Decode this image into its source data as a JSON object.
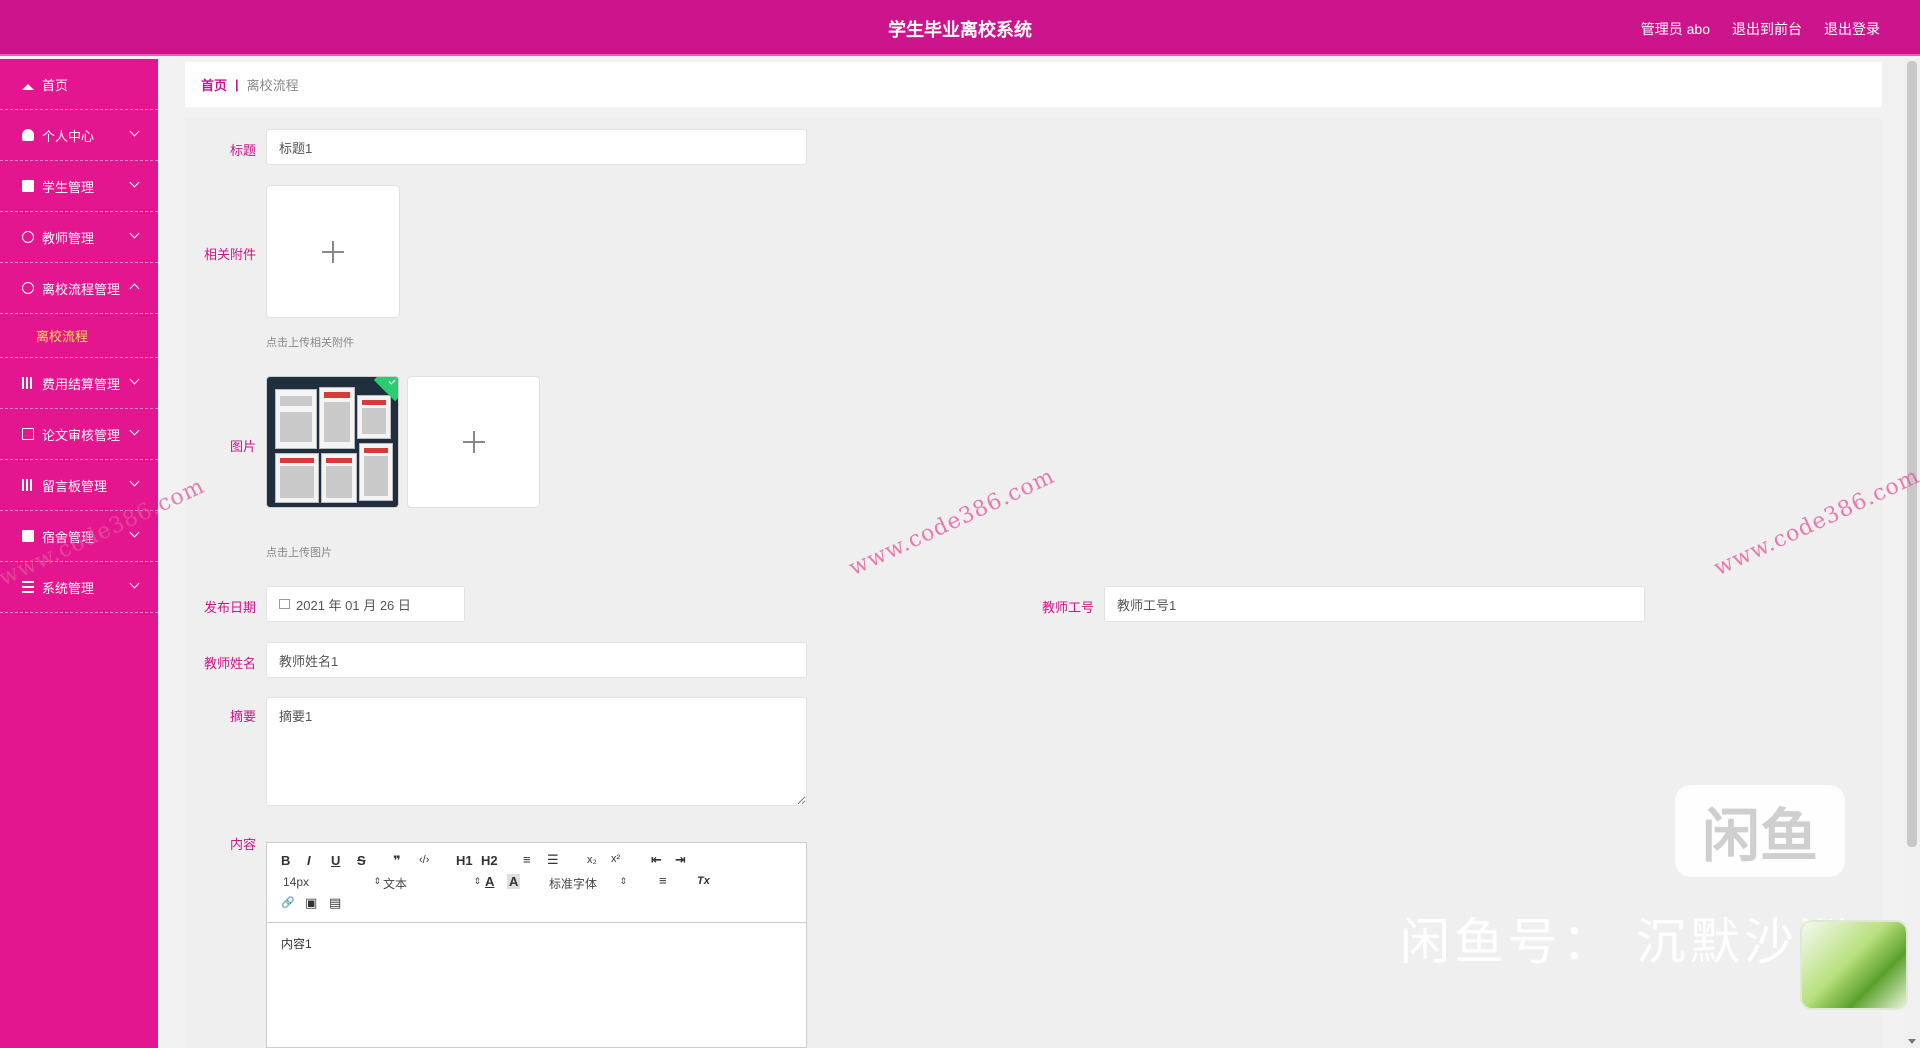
{
  "app": {
    "title": "学生毕业离校系统",
    "admin_label": "管理员 abo",
    "back_to_frontend": "退出到前台",
    "logout": "退出登录"
  },
  "sidebar": {
    "items": [
      {
        "label": "首页",
        "icon": "home-icon"
      },
      {
        "label": "个人中心",
        "icon": "user-icon"
      },
      {
        "label": "学生管理",
        "icon": "student-icon"
      },
      {
        "label": "教师管理",
        "icon": "teacher-icon"
      },
      {
        "label": "离校流程管理",
        "icon": "process-icon"
      },
      {
        "label": "离校流程",
        "icon": ""
      },
      {
        "label": "费用结算管理",
        "icon": "fee-icon"
      },
      {
        "label": "论文审核管理",
        "icon": "paper-icon"
      },
      {
        "label": "留言板管理",
        "icon": "message-icon"
      },
      {
        "label": "宿舍管理",
        "icon": "dorm-icon"
      },
      {
        "label": "系统管理",
        "icon": "settings-icon"
      }
    ]
  },
  "breadcrumb": {
    "home": "首页",
    "separator": "|",
    "current": "离校流程"
  },
  "form": {
    "title_label": "标题",
    "title_value": "标题1",
    "attachment_label": "相关附件",
    "attachment_hint": "点击上传相关附件",
    "image_label": "图片",
    "image_hint": "点击上传图片",
    "date_label": "发布日期",
    "date_value": "2021 年 01 月 26 日",
    "teacher_id_label": "教师工号",
    "teacher_id_value": "教师工号1",
    "teacher_name_label": "教师姓名",
    "teacher_name_value": "教师姓名1",
    "summary_label": "摘要",
    "summary_value": "摘要1",
    "content_label": "内容",
    "content_value": "内容1"
  },
  "editor": {
    "font_size": "14px",
    "paragraph": "文本",
    "font_family": "标准字体",
    "buttons": {
      "bold": "B",
      "italic": "I",
      "underline": "U",
      "strike": "S",
      "quote": "❞",
      "code": "‹/›",
      "h1": "H1",
      "h2": "H2",
      "ol": "≡",
      "ul": "☰",
      "sub": "x₂",
      "sup": "x²",
      "outdent": "⇤",
      "indent": "⇥",
      "color": "A",
      "bg": "A",
      "align": "≡",
      "clear": "Tx",
      "link": "🔗",
      "image": "▣",
      "video": "▤"
    }
  },
  "watermarks": {
    "site": "www.code386.com",
    "fish_logo": "闲鱼",
    "fish_id": "闲鱼号： 沉默沙洲"
  },
  "colors": {
    "brand": "#cc148d",
    "sidebar": "#e4168f",
    "active_sub": "#ffe04d"
  }
}
